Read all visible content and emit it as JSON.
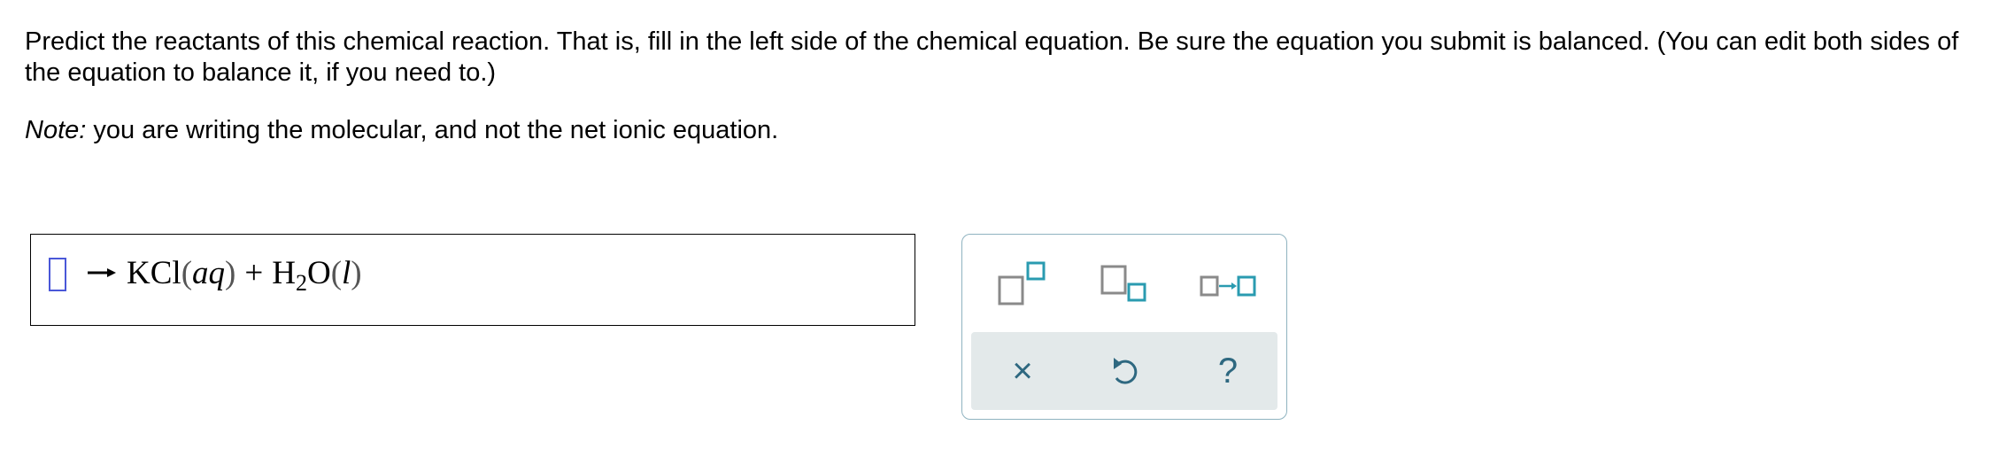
{
  "question": {
    "prompt": "Predict the reactants of this chemical reaction. That is, fill in the left side of the chemical equation. Be sure the equation you submit is balanced. (You can edit both sides of the equation to balance it, if you need to.)",
    "note_lead": "Note:",
    "note_text": " you are writing the molecular, and not the net ionic equation."
  },
  "equation": {
    "arrow_icon": "right-arrow-icon",
    "product1_formula": "KCl",
    "product1_state": "aq",
    "plus": "+",
    "product2_base": "H",
    "product2_subscript": "2",
    "product2_tail": "O",
    "product2_state": "l",
    "paren_open": "(",
    "paren_close": ")"
  },
  "palette": {
    "tools": [
      {
        "name": "superscript-tool",
        "icon": "superscript-icon"
      },
      {
        "name": "subscript-tool",
        "icon": "subscript-icon"
      },
      {
        "name": "reaction-arrow-tool",
        "icon": "reaction-arrow-icon"
      }
    ],
    "actions": {
      "clear_glyph": "×",
      "undo_icon": "undo-icon",
      "help_glyph": "?"
    }
  },
  "colors": {
    "slot_border": "#4a57d8",
    "icon_gray": "#8a8a8a",
    "icon_teal": "#2a9bb0",
    "action_bar": "#e3e9ea",
    "palette_border": "#8fb3c0",
    "action_icon": "#2e6880"
  }
}
